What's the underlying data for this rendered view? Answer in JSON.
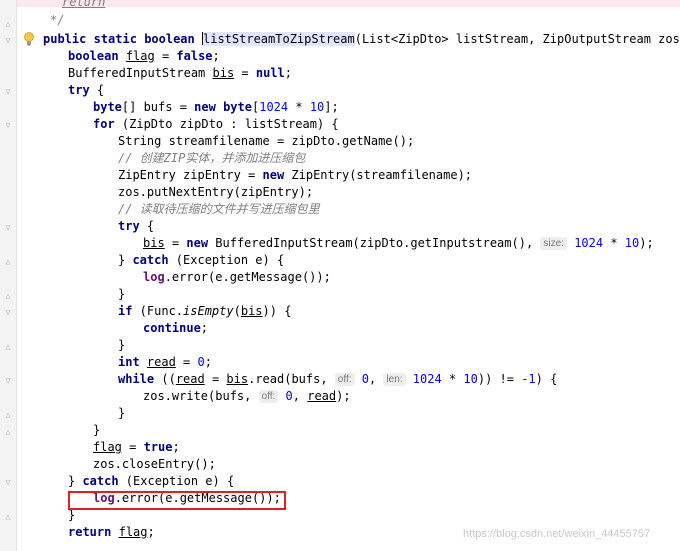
{
  "editor": {
    "lines": {
      "l_cont": "return",
      "l_comment_end": "*/",
      "sig_public": "public",
      "sig_static": "static",
      "sig_boolean": "boolean",
      "sig_name": "listStreamToZipStream",
      "sig_rest": "(List<ZipDto> listStream, ZipOutputStream zos) {",
      "flag_kw": "boolean",
      "flag_var": "flag",
      "flag_eq": " = ",
      "flag_val": "false",
      "bis_type": "BufferedInputStream ",
      "bis_var": "bis",
      "bis_eq": " = ",
      "bis_null": "null",
      "try1": "try",
      "byte1": "byte",
      "bufs_mid": "[] bufs = ",
      "new1": "new",
      "byte2": "byte",
      "n1024": "1024",
      "times": " * ",
      "n10": "10",
      "for_kw": "for",
      "for_rest": " (ZipDto zipDto : listStream) {",
      "stream_name": "String streamfilename = zipDto.getName();",
      "comment1": "// 创建ZIP实体，并添加进压缩包",
      "zipentry_a": "ZipEntry zipEntry = ",
      "new2": "new",
      "zipentry_b": " ZipEntry(streamfilename);",
      "put_next": "zos.putNextEntry(zipEntry);",
      "comment2": "// 读取待压缩的文件并写进压缩包里",
      "try2": "try",
      "bis_assign_var": "bis",
      "bis_assign_eq": " = ",
      "new3": "new",
      "bis_assign_rest": " BufferedInputStream(zipDto.getInputstream(), ",
      "hint_size": "size:",
      "n1024b": "1024",
      "n10b": "10",
      "catch1": "catch",
      "catch_rest": " (Exception e) {",
      "log1_var": "log",
      "log1_rest": ".error(e.getMessage());",
      "if_kw": "if",
      "if_a": " (Func.",
      "if_method": "isEmpty",
      "if_var": "bis",
      "continue_kw": "continue",
      "int_kw": "int",
      "read_var": "read",
      "n0": "0",
      "while_kw": "while",
      "while_a": " ((",
      "while_read": "read",
      "while_eq": " = ",
      "while_bis": "bis",
      "while_b": ".read(bufs, ",
      "hint_off": "off:",
      "n0b": "0",
      "hint_len": "len:",
      "n1024c": "1024",
      "n10c": "10",
      "while_c": ")) != ",
      "neg1": "-1",
      "write_a": "zos.write(bufs, ",
      "hint_off2": "off:",
      "n0c": "0",
      "write_read": "read",
      "flag2_var": "flag",
      "true_kw": "true",
      "close_entry": "zos.closeEntry();",
      "catch2": "catch",
      "catch2_rest": " (Exception e) {",
      "log2_var": "log",
      "log2_rest": ".error(e.getMessage());",
      "return_kw": "return",
      "return_var": "flag"
    }
  },
  "watermark": "https://blog.csdn.net/weixin_44455757"
}
